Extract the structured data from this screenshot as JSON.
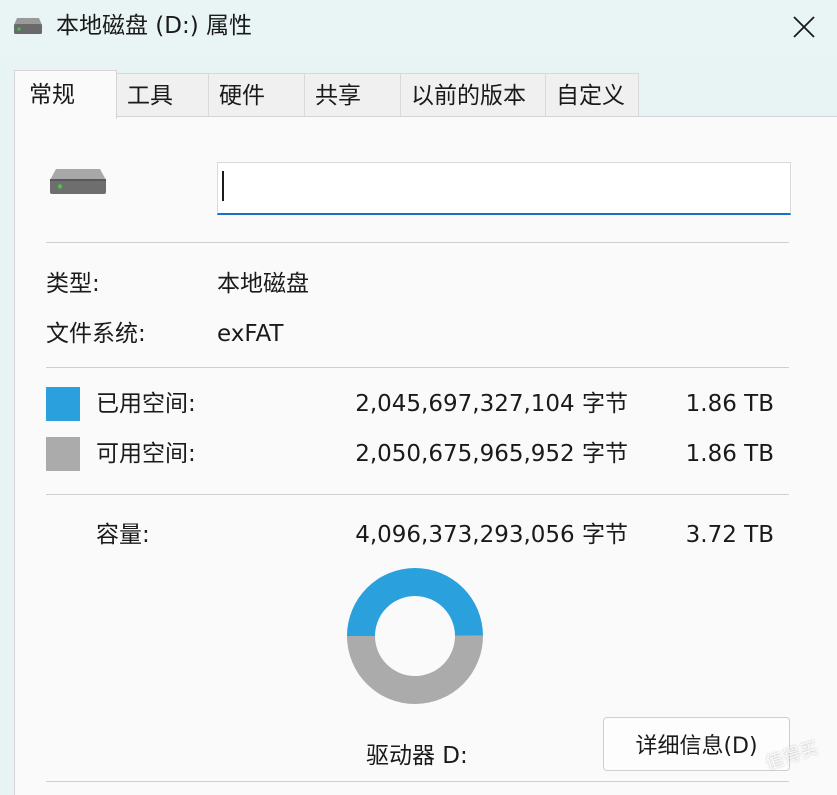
{
  "window": {
    "title": "本地磁盘 (D:) 属性",
    "close_icon": "close-icon",
    "title_icon": "drive-icon"
  },
  "tabs": [
    {
      "label": "常规",
      "active": true
    },
    {
      "label": "工具",
      "active": false
    },
    {
      "label": "硬件",
      "active": false
    },
    {
      "label": "共享",
      "active": false
    },
    {
      "label": "以前的版本",
      "active": false
    },
    {
      "label": "自定义",
      "active": false
    }
  ],
  "general": {
    "drive_icon": "hard-drive-icon",
    "name_value": "",
    "type_label": "类型:",
    "type_value": "本地磁盘",
    "fs_label": "文件系统:",
    "fs_value": "exFAT"
  },
  "space": {
    "used": {
      "label": "已用空间:",
      "bytes": "2,045,697,327,104 字节",
      "size": "1.86 TB",
      "color": "#2aa0dc"
    },
    "free": {
      "label": "可用空间:",
      "bytes": "2,050,675,965,952 字节",
      "size": "1.86 TB",
      "color": "#ababab"
    },
    "capacity": {
      "label": "容量:",
      "bytes": "4,096,373,293,056 字节",
      "size": "3.72 TB"
    }
  },
  "chart_data": {
    "type": "pie",
    "categories": [
      "已用空间",
      "可用空间"
    ],
    "values": [
      2045697327104,
      2050675965952
    ],
    "colors": [
      "#2aa0dc",
      "#ababab"
    ],
    "title": "",
    "donut": true
  },
  "drive_label": "驱动器 D:",
  "details_button": "详细信息(D)",
  "watermark": "值得买"
}
